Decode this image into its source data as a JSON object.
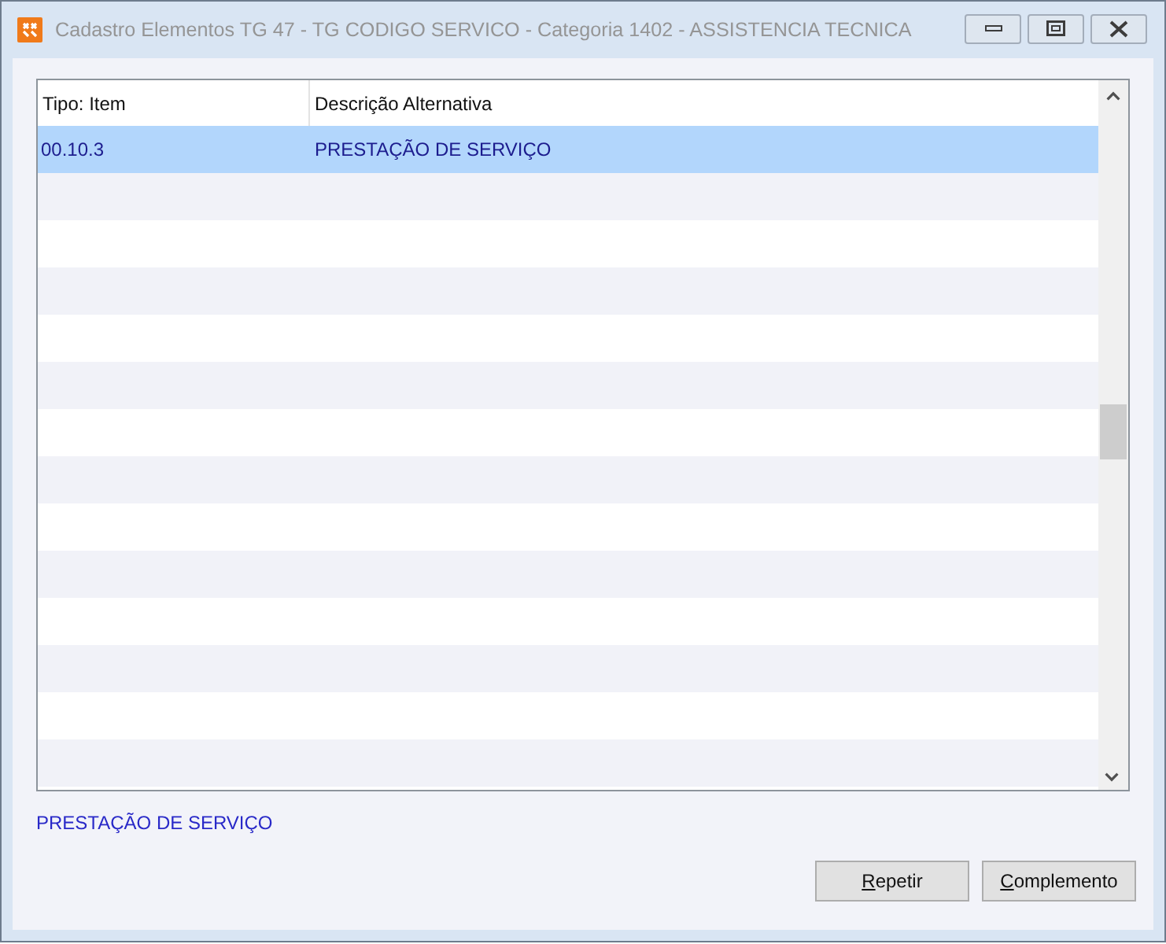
{
  "window": {
    "title": "Cadastro Elementos TG 47 - TG CODIGO SERVICO - Categoria 1402 - ASSISTENCIA TECNICA",
    "controls": [
      {
        "kind": "minimize"
      },
      {
        "kind": "restore"
      },
      {
        "kind": "close"
      }
    ]
  },
  "table": {
    "columns": [
      "Tipo: Item",
      "Descrição Alternativa"
    ],
    "rows": [
      {
        "cells": [
          "00.10.3",
          "PRESTAÇÃO DE SERVIÇO"
        ],
        "selected": true
      }
    ]
  },
  "description": "PRESTAÇÃO DE SERVIÇO",
  "buttons": [
    {
      "label": "Repetir",
      "mnemonic_underlined": true
    },
    {
      "label": "Complemento",
      "mnemonic_underlined": true
    }
  ]
}
